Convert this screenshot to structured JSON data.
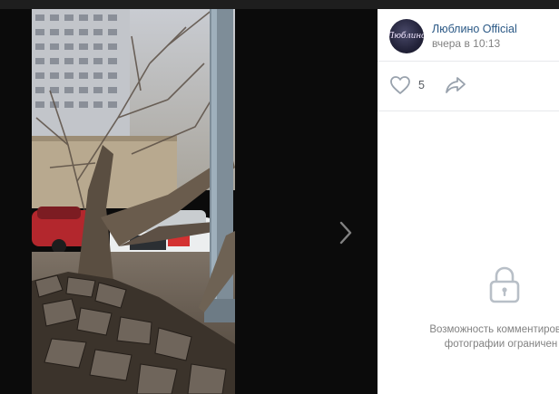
{
  "post": {
    "author_name": "Люблино Official",
    "avatar_text": "Люблино",
    "time": "вчера в 10:13",
    "likes": "5"
  },
  "comments": {
    "line1": "Возможность комментирован",
    "line2": "фотографии ограничен"
  },
  "icons": {
    "like": "heart-icon",
    "share": "share-arrow-icon",
    "next": "chevron-right-icon",
    "lock": "lock-icon"
  },
  "colors": {
    "author_link": "#2a5885",
    "muted_text": "#828282",
    "icon": "#99a2ad",
    "viewer_bg": "#0b0b0b"
  }
}
